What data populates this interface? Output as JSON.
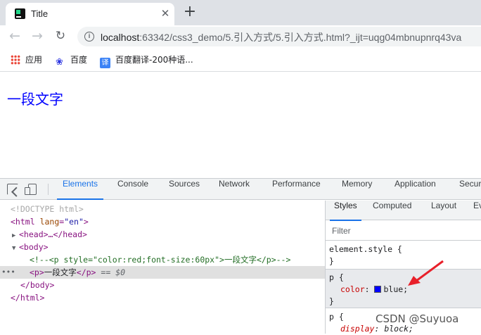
{
  "browser": {
    "tab_title": "Title",
    "tab_close": "✕",
    "new_tab": "+",
    "back": "←",
    "forward": "→",
    "reload": "↻",
    "info": "i",
    "url_host": "localhost",
    "url_rest": ":63342/css3_demo/5.引入方式/5.引入方式.html?_ijt=uqg04mbnupnrq43va",
    "bookmarks": [
      {
        "label": "应用",
        "icon": "apps-grid-icon"
      },
      {
        "label": "百度",
        "icon": "baidu-paw-icon"
      },
      {
        "label": "百度翻译-200种语...",
        "icon": "baidu-translate-icon",
        "icon_text": "译"
      }
    ]
  },
  "page": {
    "paragraph": "一段文字",
    "paragraph_color": "#0000ff"
  },
  "devtools": {
    "tabs": [
      "Elements",
      "Console",
      "Sources",
      "Network",
      "Performance",
      "Memory",
      "Application",
      "Secur"
    ],
    "active_tab": "Elements",
    "tree": {
      "doctype": "<!DOCTYPE html>",
      "html_open": "<html",
      "html_attr": "lang",
      "html_attr_val": "\"en\"",
      "html_close_bracket": ">",
      "head_tri": "▶",
      "head": "<head>…</head>",
      "body_tri": "▼",
      "body_open": "<body>",
      "comment": "<!--<p style=\"color:red;font-size:60px\">一段文字</p>-->",
      "dots": "•••",
      "p_open": "<p>",
      "p_text": "一段文字",
      "p_close": "</p>",
      "selected_marker": "== $0",
      "body_close": "</body>",
      "html_close": "</html>"
    },
    "styles_tabs": [
      "Styles",
      "Computed",
      "Layout",
      "Ev"
    ],
    "active_styles_tab": "Styles",
    "filter_placeholder": "Filter",
    "rules": {
      "element_style_selector": "element.style {",
      "close_brace": "}",
      "p_selector": "p {",
      "color_prop": "color",
      "color_value": "blue;",
      "display_prop": "display",
      "display_value": "block;"
    }
  },
  "watermark": "CSDN @Suyuoa",
  "colors": {
    "accent": "#1a73e8",
    "arrow": "#e8202a",
    "swatch": "#0000ff"
  }
}
